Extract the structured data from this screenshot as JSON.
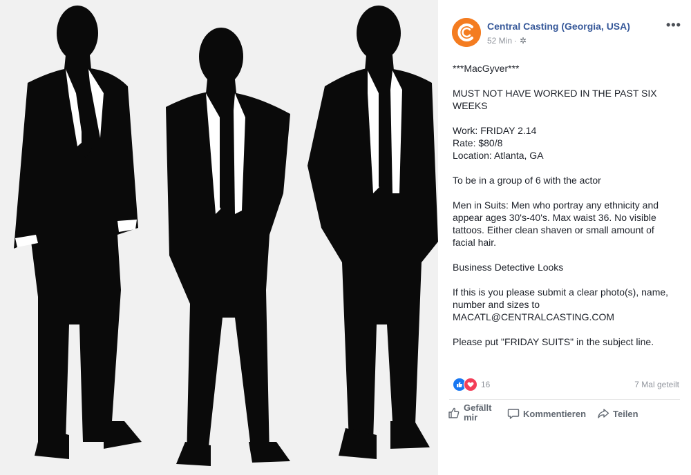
{
  "post": {
    "page_name": "Central Casting (Georgia, USA)",
    "time": "52 Min",
    "separator": "·",
    "privacy_icon": "gear-icon",
    "more_label": "•••",
    "paragraphs": [
      "***MacGyver***",
      "MUST NOT HAVE WORKED IN THE PAST SIX WEEKS",
      "Work: FRIDAY 2.14\nRate: $80/8\nLocation: Atlanta, GA",
      "To be in a group of 6 with the actor",
      "Men in Suits: Men who portray any ethnicity and appear ages 30's-40's. Max waist 36. No visible tattoos. Either clean shaven or small amount of facial hair.",
      "Business Detective Looks",
      "If this is you please submit a clear photo(s), name, number and sizes to MACATL@CENTRALCASTING.COM",
      "Please put \"FRIDAY SUITS\" in the subject line."
    ]
  },
  "stats": {
    "reaction_count": "16",
    "reaction_icons": [
      "like-icon",
      "love-icon"
    ],
    "shares": "7 Mal geteilt"
  },
  "actions": {
    "like": "Gefällt mir",
    "comment": "Kommentieren",
    "share": "Teilen"
  },
  "colors": {
    "link_blue": "#365899",
    "brand_orange": "#f47c20",
    "like_blue": "#1877f2",
    "love_red": "#f33e58",
    "photo_bg": "#f1f1f1"
  }
}
